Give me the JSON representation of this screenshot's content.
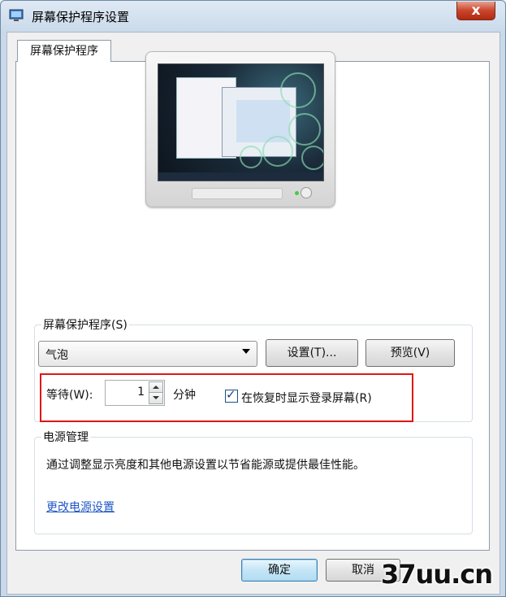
{
  "window": {
    "title": "屏幕保护程序设置",
    "close_label": "x"
  },
  "tab": {
    "label": "屏幕保护程序"
  },
  "screensaver": {
    "legend": "屏幕保护程序(S)",
    "selected": "气泡",
    "settings_button": "设置(T)...",
    "preview_button": "预览(V)",
    "wait_label": "等待(W):",
    "wait_value": "1",
    "wait_unit": "分钟",
    "resume_label": "在恢复时显示登录屏幕(R)",
    "resume_checked": true
  },
  "power": {
    "legend": "电源管理",
    "description": "通过调整显示亮度和其他电源设置以节省能源或提供最佳性能。",
    "link": "更改电源设置"
  },
  "footer": {
    "ok_button": "确定",
    "cancel_button": "取消"
  },
  "watermark": "37uu.cn",
  "colors": {
    "highlight": "#e01616",
    "link": "#1f57c5"
  }
}
